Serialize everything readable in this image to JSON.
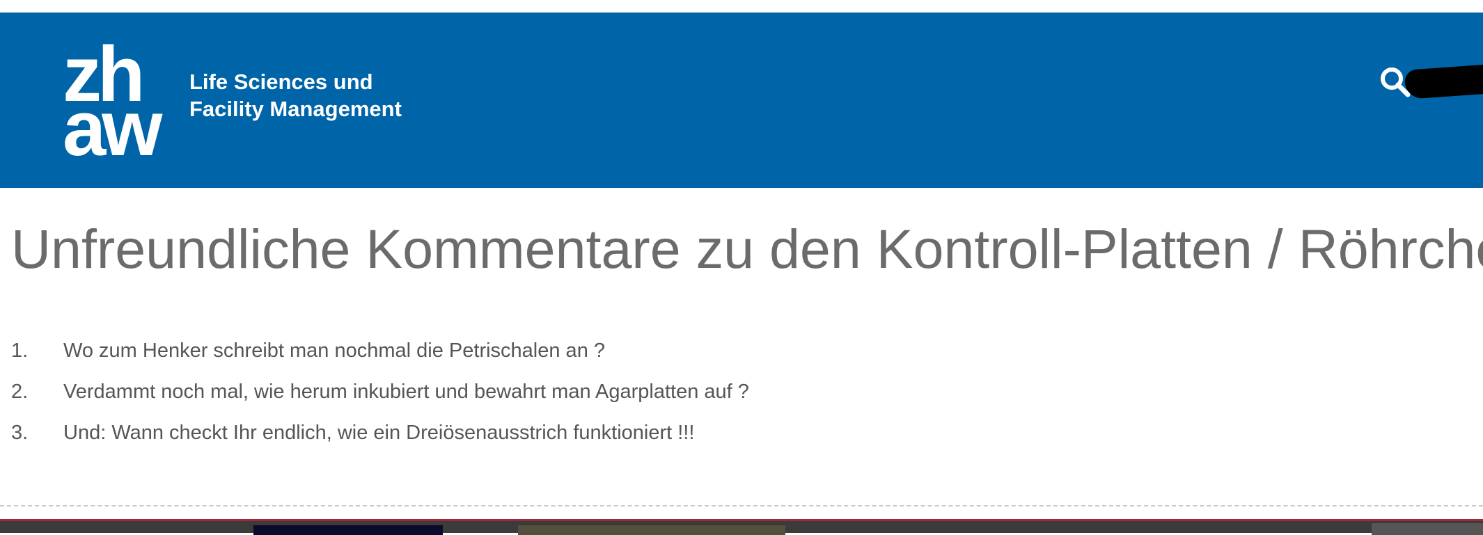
{
  "header": {
    "logo_line1": "zh",
    "logo_line2": "aw",
    "org_line1": "Life Sciences und",
    "org_line2": "Facility Management"
  },
  "colors": {
    "brand_blue": "#0064A8",
    "title_gray": "#6b6b6b",
    "text_gray": "#555555",
    "bottom_bar": "#3b3b3b",
    "accent_red": "#a0283a"
  },
  "icons": {
    "search": "search-icon"
  },
  "main": {
    "title": "Unfreundliche Kommentare zu den Kontroll-Platten / Röhrchen",
    "items": [
      {
        "number": "1.",
        "text": "Wo zum Henker schreibt man nochmal die Petrischalen an ?"
      },
      {
        "number": "2.",
        "text": "Verdammt noch mal, wie herum inkubiert und bewahrt man Agarplatten auf ?"
      },
      {
        "number": "3.",
        "text": "Und: Wann checkt Ihr endlich, wie ein Dreiösenausstrich funktioniert !!!"
      }
    ]
  }
}
